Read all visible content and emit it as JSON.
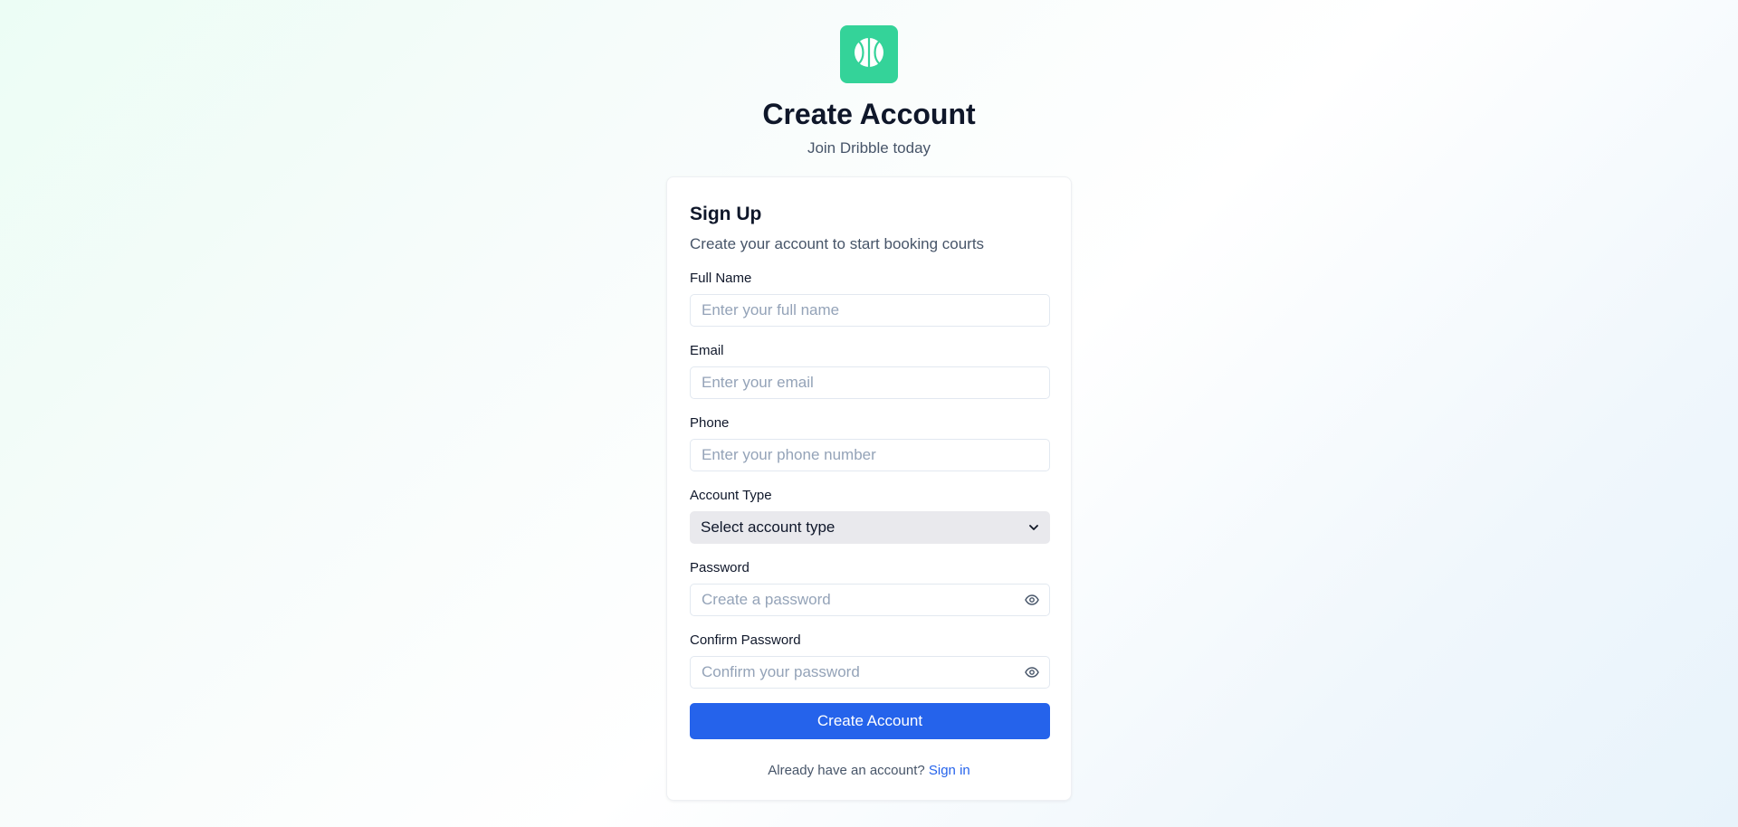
{
  "brand": {
    "logo_icon": "basketball-icon",
    "logo_color": "#34d399"
  },
  "header": {
    "title": "Create Account",
    "subtitle": "Join Dribble today"
  },
  "card": {
    "title": "Sign Up",
    "description": "Create your account to start booking courts"
  },
  "form": {
    "full_name": {
      "label": "Full Name",
      "placeholder": "Enter your full name",
      "value": ""
    },
    "email": {
      "label": "Email",
      "placeholder": "Enter your email",
      "value": ""
    },
    "phone": {
      "label": "Phone",
      "placeholder": "Enter your phone number",
      "value": ""
    },
    "account_type": {
      "label": "Account Type",
      "selected": "Select account type"
    },
    "password": {
      "label": "Password",
      "placeholder": "Create a password",
      "value": "",
      "toggle_icon": "eye-icon"
    },
    "confirm_password": {
      "label": "Confirm Password",
      "placeholder": "Confirm your password",
      "value": "",
      "toggle_icon": "eye-icon"
    },
    "submit_label": "Create Account"
  },
  "footer": {
    "prompt": "Already have an account?",
    "link_label": "Sign in"
  },
  "colors": {
    "primary": "#2563eb",
    "brand_green": "#34d399",
    "text_dark": "#0f172a",
    "text_muted": "#475569",
    "placeholder": "#94a3b8"
  }
}
